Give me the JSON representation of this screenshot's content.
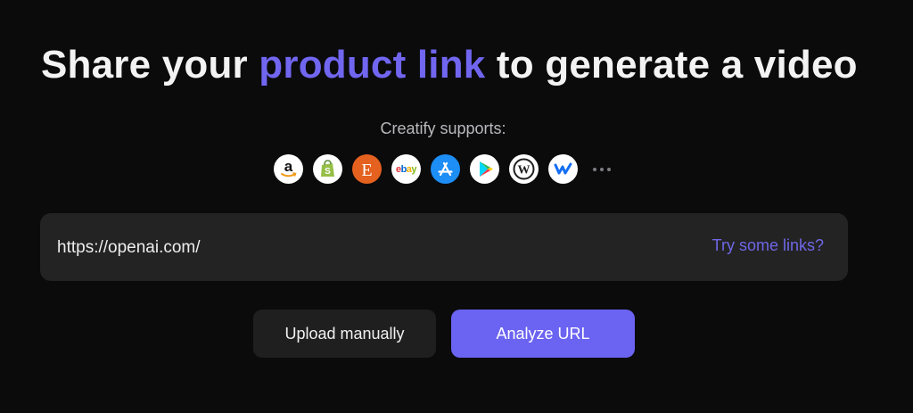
{
  "headline": {
    "part1": "Share your ",
    "accent": "product link",
    "part2": " to generate a video"
  },
  "supports": {
    "label": "Creatify supports:",
    "platforms": [
      {
        "name": "amazon-logo-icon"
      },
      {
        "name": "shopify-logo-icon"
      },
      {
        "name": "etsy-logo-icon",
        "glyph": "E"
      },
      {
        "name": "ebay-logo-icon",
        "glyph": "ebay"
      },
      {
        "name": "app-store-logo-icon"
      },
      {
        "name": "google-play-logo-icon"
      },
      {
        "name": "wordpress-logo-icon"
      },
      {
        "name": "webflow-logo-icon"
      }
    ]
  },
  "url_input": {
    "value": "https://openai.com/",
    "try_links_label": "Try some links?"
  },
  "buttons": {
    "upload_label": "Upload manually",
    "analyze_label": "Analyze URL"
  },
  "colors": {
    "accent": "#7166f0",
    "background": "#0b0b0c",
    "input_bg": "#232324",
    "button_primary": "#6b63f1"
  }
}
